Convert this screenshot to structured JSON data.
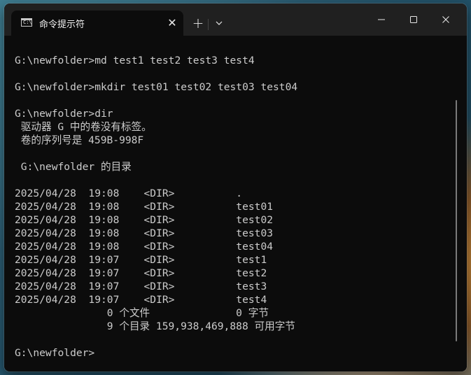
{
  "tab": {
    "title": "命令提示符",
    "icon": "cmd-icon",
    "icon_text": "C:\\"
  },
  "controls": {
    "close_tab": "✕",
    "new_tab": "+"
  },
  "terminal_lines": [
    "",
    "G:\\newfolder>md test1 test2 test3 test4",
    "",
    "G:\\newfolder>mkdir test01 test02 test03 test04",
    "",
    "G:\\newfolder>dir",
    " 驱动器 G 中的卷没有标签。",
    " 卷的序列号是 459B-998F",
    "",
    " G:\\newfolder 的目录",
    "",
    "2025/04/28  19:08    <DIR>          .",
    "2025/04/28  19:08    <DIR>          test01",
    "2025/04/28  19:08    <DIR>          test02",
    "2025/04/28  19:08    <DIR>          test03",
    "2025/04/28  19:08    <DIR>          test04",
    "2025/04/28  19:07    <DIR>          test1",
    "2025/04/28  19:07    <DIR>          test2",
    "2025/04/28  19:07    <DIR>          test3",
    "2025/04/28  19:07    <DIR>          test4",
    "               0 个文件              0 字节",
    "               9 个目录 159,938,469,888 可用字节",
    "",
    "G:\\newfolder>"
  ]
}
